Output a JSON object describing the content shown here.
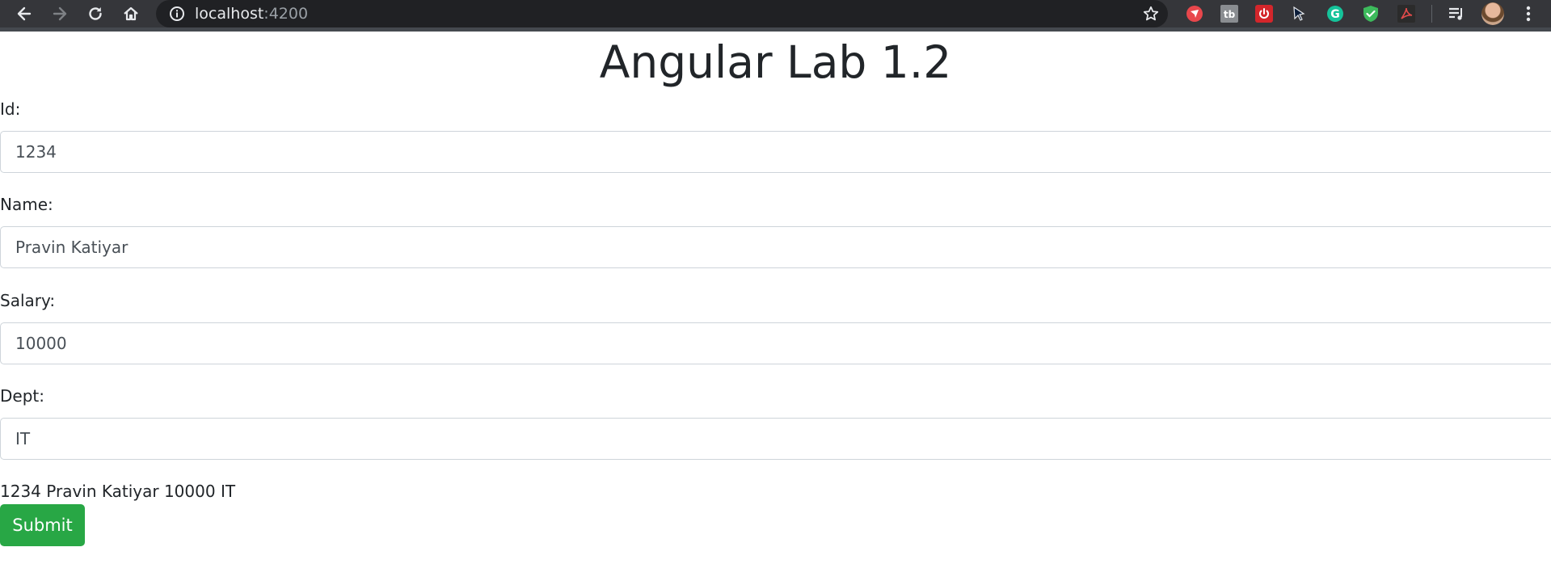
{
  "browser": {
    "url_host": "localhost",
    "url_port": ":4200",
    "icons": [
      "back-icon",
      "forward-icon",
      "reload-icon",
      "home-icon",
      "info-icon",
      "bookmark-star-icon"
    ],
    "extensions": [
      "red-extension-icon",
      "tb-extension-icon",
      "power-extension-icon",
      "cursor-extension-icon",
      "grammarly-icon",
      "shield-check-icon",
      "pdf-icon",
      "playlist-icon",
      "profile-avatar",
      "menu-kebab-icon"
    ],
    "extension_tb_text": "tb",
    "grammarly_letter": "G"
  },
  "page": {
    "title": "Angular Lab 1.2",
    "fields": [
      {
        "label": "Id:",
        "value": "1234"
      },
      {
        "label": "Name:",
        "value": "Pravin Katiyar"
      },
      {
        "label": "Salary:",
        "value": "10000"
      },
      {
        "label": "Dept:",
        "value": "IT"
      }
    ],
    "summary": "1234 Pravin Katiyar 10000 IT",
    "submit_label": "Submit"
  },
  "colors": {
    "accent_green": "#28a745",
    "toolbar": "#35363a",
    "omnibox": "#202124"
  }
}
